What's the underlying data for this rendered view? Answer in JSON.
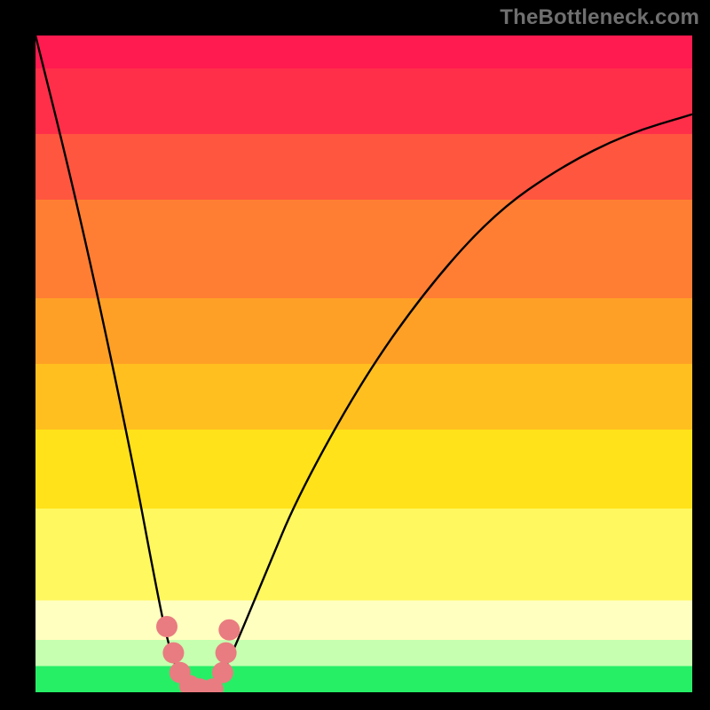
{
  "watermark": "TheBottleneck.com",
  "chart_data": {
    "type": "line",
    "title": "",
    "xlabel": "",
    "ylabel": "",
    "xlim": [
      0,
      100
    ],
    "ylim": [
      0,
      100
    ],
    "background_zones": [
      {
        "name": "red-top",
        "y0": 100,
        "y1": 95,
        "color": "#ff1a4f"
      },
      {
        "name": "red-pink",
        "y0": 95,
        "y1": 85,
        "color": "#ff2f4a"
      },
      {
        "name": "red-orange",
        "y0": 85,
        "y1": 75,
        "color": "#ff5640"
      },
      {
        "name": "orange",
        "y0": 75,
        "y1": 60,
        "color": "#ff7e33"
      },
      {
        "name": "orange-amber",
        "y0": 60,
        "y1": 50,
        "color": "#ffa026"
      },
      {
        "name": "amber",
        "y0": 50,
        "y1": 40,
        "color": "#ffbf1f"
      },
      {
        "name": "yellow",
        "y0": 40,
        "y1": 28,
        "color": "#ffe21a"
      },
      {
        "name": "pale-yellow",
        "y0": 28,
        "y1": 14,
        "color": "#fff85e"
      },
      {
        "name": "cream",
        "y0": 14,
        "y1": 8,
        "color": "#ffffc0"
      },
      {
        "name": "pale-green",
        "y0": 8,
        "y1": 4,
        "color": "#c6ffb0"
      },
      {
        "name": "green",
        "y0": 4,
        "y1": 0,
        "color": "#26ef66"
      }
    ],
    "series": [
      {
        "name": "bottleneck-curve",
        "x": [
          0,
          5,
          10,
          15,
          18,
          20,
          22,
          24,
          25,
          26,
          27,
          28,
          30,
          35,
          40,
          50,
          60,
          70,
          80,
          90,
          100
        ],
        "values": [
          100,
          80,
          58,
          34,
          18,
          8,
          2,
          0,
          0,
          0,
          0,
          2,
          6,
          18,
          30,
          48,
          62,
          73,
          80,
          85,
          88
        ]
      }
    ],
    "markers": [
      {
        "x": 20.0,
        "y": 10.0
      },
      {
        "x": 21.0,
        "y": 6.0
      },
      {
        "x": 22.0,
        "y": 3.0
      },
      {
        "x": 23.5,
        "y": 1.0
      },
      {
        "x": 25.0,
        "y": 0.5
      },
      {
        "x": 27.0,
        "y": 0.5
      },
      {
        "x": 28.5,
        "y": 3.0
      },
      {
        "x": 29.0,
        "y": 6.0
      },
      {
        "x": 29.5,
        "y": 9.5
      }
    ],
    "marker_color": "#e97c80",
    "curve_stroke": "#000000"
  }
}
